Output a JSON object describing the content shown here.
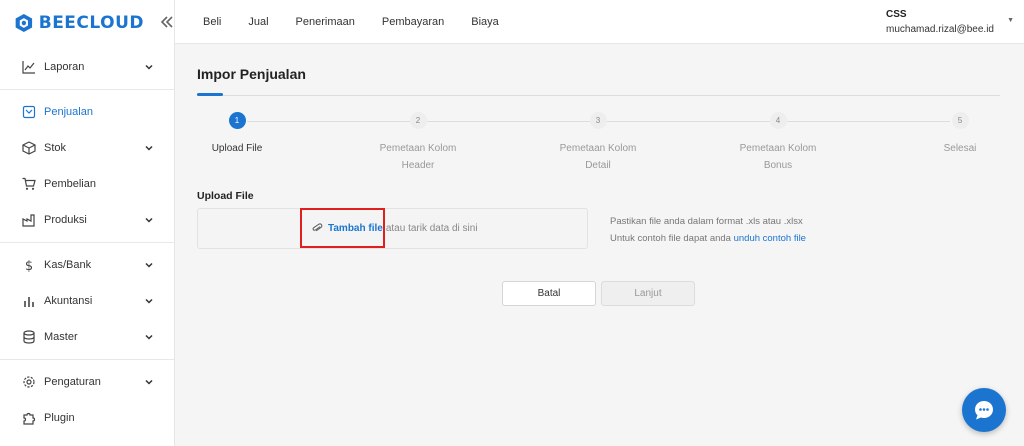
{
  "brand": {
    "name": "BEECLOUD",
    "collapse_icon": "double-chevron-left-icon",
    "color": "#1b75d0"
  },
  "sidebar": {
    "items": [
      {
        "label": "Laporan",
        "icon": "chart-line-icon",
        "has_children": true
      },
      {
        "label": "Penjualan",
        "icon": "receipt-icon",
        "has_children": false,
        "active": true
      },
      {
        "label": "Stok",
        "icon": "box-icon",
        "has_children": true
      },
      {
        "label": "Pembelian",
        "icon": "cart-icon",
        "has_children": false
      },
      {
        "label": "Produksi",
        "icon": "factory-icon",
        "has_children": true
      },
      {
        "label": "Kas/Bank",
        "icon": "dollar-icon",
        "has_children": true
      },
      {
        "label": "Akuntansi",
        "icon": "bar-chart-icon",
        "has_children": true
      },
      {
        "label": "Master",
        "icon": "database-icon",
        "has_children": true
      },
      {
        "label": "Pengaturan",
        "icon": "gear-icon",
        "has_children": true
      },
      {
        "label": "Plugin",
        "icon": "puzzle-icon",
        "has_children": false
      }
    ]
  },
  "topnav": {
    "items": [
      "Beli",
      "Jual",
      "Penerimaan",
      "Pembayaran",
      "Biaya"
    ]
  },
  "user": {
    "org": "CSS",
    "email": "muchamad.rizal@bee.id"
  },
  "page": {
    "title": "Impor Penjualan"
  },
  "stepper": {
    "steps": [
      {
        "number": "1",
        "label_line1": "Upload File",
        "label_line2": "",
        "active": true
      },
      {
        "number": "2",
        "label_line1": "Pemetaan Kolom",
        "label_line2": "Header",
        "active": false
      },
      {
        "number": "3",
        "label_line1": "Pemetaan Kolom",
        "label_line2": "Detail",
        "active": false
      },
      {
        "number": "4",
        "label_line1": "Pemetaan Kolom",
        "label_line2": "Bonus",
        "active": false
      },
      {
        "number": "5",
        "label_line1": "Selesai",
        "label_line2": "",
        "active": false
      }
    ]
  },
  "upload": {
    "label": "Upload File",
    "add_file": "Tambah file",
    "drop_hint": "atau tarik data di sini",
    "info_line1": "Pastikan file anda dalam format .xls atau .xlsx",
    "info_line2_prefix": "Untuk contoh file dapat anda",
    "info_link": "unduh contoh file"
  },
  "buttons": {
    "cancel": "Batal",
    "next": "Lanjut"
  },
  "colors": {
    "accent": "#1b75d0",
    "highlight": "#e0201f"
  }
}
